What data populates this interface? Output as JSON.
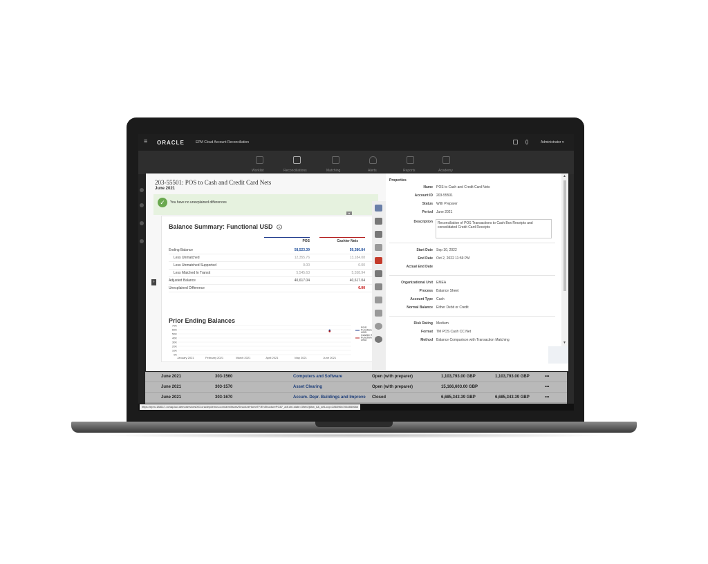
{
  "header": {
    "logo": "ORACLE",
    "app_title": "EPM Cloud Account Reconciliation",
    "user": "Administrator ▾"
  },
  "nav": {
    "items": [
      "Worklist",
      "Reconciliations",
      "Matching",
      "Alerts",
      "Reports",
      "Academy"
    ]
  },
  "dialog": {
    "title": "203-55501: POS to Cash and Credit Card Nets",
    "period": "June 2021",
    "notice": "You have no unexplained differences",
    "balance_summary": {
      "title": "Balance Summary: Functional USD",
      "columns": [
        "POS",
        "Cashier Nets"
      ],
      "rows": [
        {
          "label": "Ending Balance",
          "pos": "58,523.39",
          "cashier": "59,380.84"
        },
        {
          "label": "Less Unmatched",
          "pos": "12,355.76",
          "cashier": "13,184.08"
        },
        {
          "label": "Less Unmatched Supported",
          "pos": "0.00",
          "cashier": "0.00"
        },
        {
          "label": "Less Matched In Transit",
          "pos": "5,545.63",
          "cashier": "5,558.94"
        },
        {
          "label": "Adjusted Balance",
          "pos": "40,617.04",
          "cashier": "40,617.04"
        },
        {
          "label": "Unexplained Difference",
          "pos": "",
          "cashier": "0.00"
        }
      ]
    },
    "prior_balances_title": "Prior Ending Balances",
    "properties": {
      "heading": "Properties",
      "name_label": "Name",
      "name": "POS to Cash and Credit Card Nets",
      "account_id_label": "Account ID",
      "account_id": "203-55501",
      "status_label": "Status",
      "status": "With Preparer",
      "period_label": "Period",
      "period": "June 2021",
      "description_label": "Description",
      "description": "Reconciliation of POS Transactions to Cash Box Receipts and consolidated Credit Card Receipts",
      "start_date_label": "Start Date",
      "start_date": "Sep 10, 2022",
      "end_date_label": "End Date",
      "end_date": "Oct 2, 2022 11:59 PM",
      "actual_end_label": "Actual End Date",
      "actual_end": "",
      "org_unit_label": "Organizational Unit",
      "org_unit": "EMEA",
      "process_label": "Process",
      "process": "Balance Sheet",
      "account_type_label": "Account Type",
      "account_type": "Cash",
      "normal_balance_label": "Normal Balance",
      "normal_balance": "Either Debit or Credit",
      "risk_label": "Risk Rating",
      "risk": "Medium",
      "format_label": "Format",
      "format": "TM POS Cash CC Net",
      "method_label": "Method",
      "method": "Balance Comparison with Transaction Matching"
    }
  },
  "chart_data": {
    "type": "line",
    "title": "Prior Ending Balances",
    "categories": [
      "January 2021",
      "February 2021",
      "March 2021",
      "April 2021",
      "May 2021",
      "June 2021"
    ],
    "y_ticks": [
      "0K",
      "10K",
      "20K",
      "30K",
      "40K",
      "50K",
      "60K",
      "70K"
    ],
    "ylim": [
      0,
      70000
    ],
    "series": [
      {
        "name": "POS Functional USD",
        "values": [
          null,
          null,
          null,
          null,
          null,
          58523.39
        ],
        "color": "#1f3b8c"
      },
      {
        "name": "Cashier Nets Functional USD",
        "values": [
          null,
          null,
          null,
          null,
          null,
          59380.84
        ],
        "color": "#b31b1b"
      }
    ],
    "legend": "right"
  },
  "list_rows": [
    {
      "period": "June 2021",
      "account": "303-1560",
      "name": "Computers and Software",
      "status": "Open (with preparer)",
      "amount1": "1,103,793.00 GBP",
      "amount2": "1,103,793.00 GBP",
      "more": "•••"
    },
    {
      "period": "June 2021",
      "account": "303-1570",
      "name": "Asset Clearing",
      "status": "Open (with preparer)",
      "amount1": "15,166,603.00 GBP",
      "amount2": "",
      "more": "•••"
    },
    {
      "period": "June 2021",
      "account": "303-1670",
      "name": "Accum. Depr. Buildings and Improve",
      "status": "Closed",
      "amount1": "6,685,343.39 GBP",
      "amount2": "6,685,343.39 GBP",
      "more": "•••"
    }
  ],
  "status_url": "https://epm-188117-xchap.iad.demoservices003.oraclepdemos.com/arm/faces/StructureHomeTF/EhStructurePG87_adf.ctrl-state=39eb2j6hw_6&_afrLoop=2860966706485068#",
  "colors": {
    "pos_line": "#1f3b8c",
    "cashier_line": "#b31b1b",
    "notice_bg": "#e6f2df",
    "check": "#6aa84f"
  }
}
